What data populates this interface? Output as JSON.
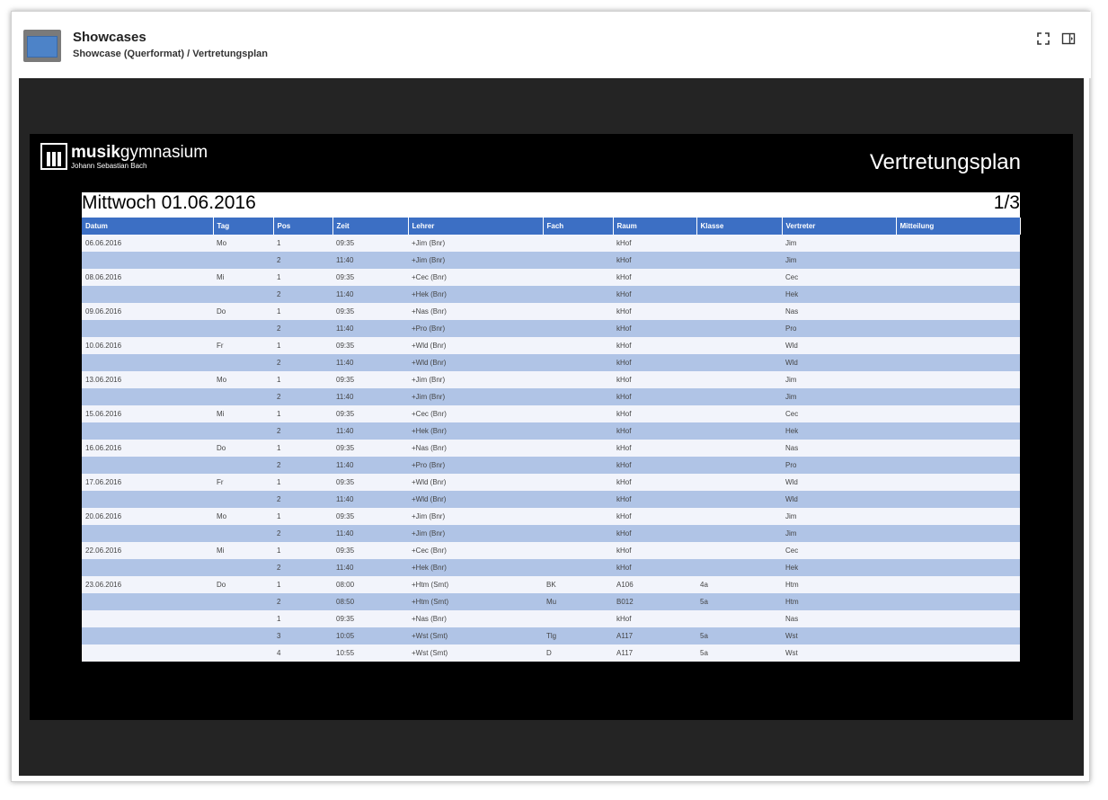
{
  "header": {
    "title": "Showcases",
    "breadcrumb": "Showcase (Querformat) / Vertretungsplan",
    "icons": {
      "app": "monitor-icon",
      "fullscreen": "fullscreen-icon",
      "panel": "side-panel-icon"
    }
  },
  "display": {
    "logo": {
      "brand_bold": "musik",
      "brand_light": "gymnasium",
      "subtitle": "Johann Sebastian Bach"
    },
    "plan_title": "Vertretungsplan",
    "day": "Mittwoch 01.06.2016",
    "page": "1/3",
    "columns": [
      "Datum",
      "Tag",
      "Pos",
      "Zeit",
      "Lehrer",
      "Fach",
      "Raum",
      "Klasse",
      "Vertreter",
      "Mitteilung"
    ],
    "rows": [
      [
        "06.06.2016",
        "Mo",
        "1",
        "09:35",
        "+Jim (Bnr)",
        "",
        "kHof",
        "",
        "Jim",
        ""
      ],
      [
        "",
        "",
        "2",
        "11:40",
        "+Jim (Bnr)",
        "",
        "kHof",
        "",
        "Jim",
        ""
      ],
      [
        "08.06.2016",
        "Mi",
        "1",
        "09:35",
        "+Cec (Bnr)",
        "",
        "kHof",
        "",
        "Cec",
        ""
      ],
      [
        "",
        "",
        "2",
        "11:40",
        "+Hek (Bnr)",
        "",
        "kHof",
        "",
        "Hek",
        ""
      ],
      [
        "09.06.2016",
        "Do",
        "1",
        "09:35",
        "+Nas (Bnr)",
        "",
        "kHof",
        "",
        "Nas",
        ""
      ],
      [
        "",
        "",
        "2",
        "11:40",
        "+Pro (Bnr)",
        "",
        "kHof",
        "",
        "Pro",
        ""
      ],
      [
        "10.06.2016",
        "Fr",
        "1",
        "09:35",
        "+Wld (Bnr)",
        "",
        "kHof",
        "",
        "Wld",
        ""
      ],
      [
        "",
        "",
        "2",
        "11:40",
        "+Wld (Bnr)",
        "",
        "kHof",
        "",
        "Wld",
        ""
      ],
      [
        "13.06.2016",
        "Mo",
        "1",
        "09:35",
        "+Jim (Bnr)",
        "",
        "kHof",
        "",
        "Jim",
        ""
      ],
      [
        "",
        "",
        "2",
        "11:40",
        "+Jim (Bnr)",
        "",
        "kHof",
        "",
        "Jim",
        ""
      ],
      [
        "15.06.2016",
        "Mi",
        "1",
        "09:35",
        "+Cec (Bnr)",
        "",
        "kHof",
        "",
        "Cec",
        ""
      ],
      [
        "",
        "",
        "2",
        "11:40",
        "+Hek (Bnr)",
        "",
        "kHof",
        "",
        "Hek",
        ""
      ],
      [
        "16.06.2016",
        "Do",
        "1",
        "09:35",
        "+Nas (Bnr)",
        "",
        "kHof",
        "",
        "Nas",
        ""
      ],
      [
        "",
        "",
        "2",
        "11:40",
        "+Pro (Bnr)",
        "",
        "kHof",
        "",
        "Pro",
        ""
      ],
      [
        "17.06.2016",
        "Fr",
        "1",
        "09:35",
        "+Wld (Bnr)",
        "",
        "kHof",
        "",
        "Wld",
        ""
      ],
      [
        "",
        "",
        "2",
        "11:40",
        "+Wld (Bnr)",
        "",
        "kHof",
        "",
        "Wld",
        ""
      ],
      [
        "20.06.2016",
        "Mo",
        "1",
        "09:35",
        "+Jim (Bnr)",
        "",
        "kHof",
        "",
        "Jim",
        ""
      ],
      [
        "",
        "",
        "2",
        "11:40",
        "+Jim (Bnr)",
        "",
        "kHof",
        "",
        "Jim",
        ""
      ],
      [
        "22.06.2016",
        "Mi",
        "1",
        "09:35",
        "+Cec (Bnr)",
        "",
        "kHof",
        "",
        "Cec",
        ""
      ],
      [
        "",
        "",
        "2",
        "11:40",
        "+Hek (Bnr)",
        "",
        "kHof",
        "",
        "Hek",
        ""
      ],
      [
        "23.06.2016",
        "Do",
        "1",
        "08:00",
        "+Htm (Smt)",
        "BK",
        "A106",
        "4a",
        "Htm",
        ""
      ],
      [
        "",
        "",
        "2",
        "08:50",
        "+Htm (Smt)",
        "Mu",
        "B012",
        "5a",
        "Htm",
        ""
      ],
      [
        "",
        "",
        "1",
        "09:35",
        "+Nas (Bnr)",
        "",
        "kHof",
        "",
        "Nas",
        ""
      ],
      [
        "",
        "",
        "3",
        "10:05",
        "+Wst (Smt)",
        "Tlg",
        "A117",
        "5a",
        "Wst",
        ""
      ],
      [
        "",
        "",
        "4",
        "10:55",
        "+Wst (Smt)",
        "D",
        "A117",
        "5a",
        "Wst",
        ""
      ]
    ]
  },
  "colors": {
    "header_row": "#3c6fc4",
    "row_light": "#f2f4fb",
    "row_dark": "#b0c4e6",
    "stage": "#242424",
    "screen": "#000000"
  }
}
